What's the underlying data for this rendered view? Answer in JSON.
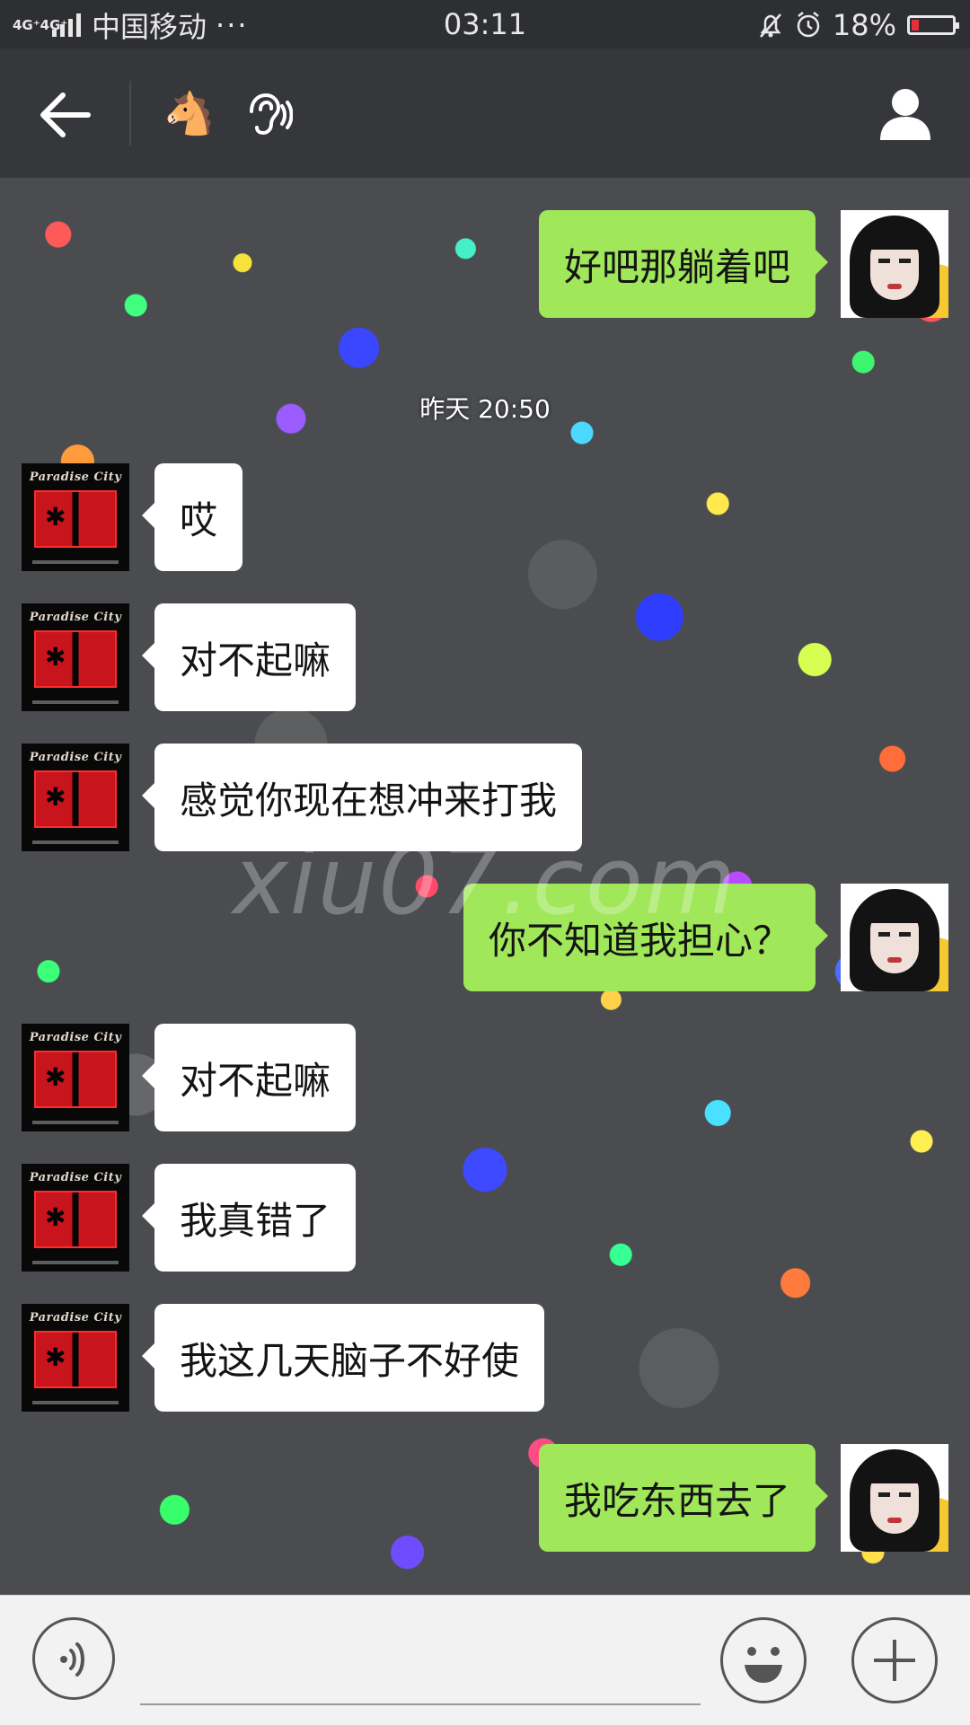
{
  "status_bar": {
    "network": "4G⁺4G⁺",
    "carrier": "中国移动",
    "more": "···",
    "time": "03:11",
    "battery": "18%",
    "battery_level": 0.18,
    "battery_color": "#e3303a"
  },
  "header": {
    "back_icon": "arrow-left-icon",
    "contact_emoji": "🐴",
    "earpiece_icon": "earpiece-icon",
    "profile_icon": "person-icon"
  },
  "avatars": {
    "peer_logo_text": "Paradise City"
  },
  "messages": [
    {
      "from": "self",
      "text": "好吧那躺着吧"
    },
    {
      "type": "timestamp",
      "text": "昨天 20:50"
    },
    {
      "from": "peer",
      "text": "哎"
    },
    {
      "from": "peer",
      "text": "对不起嘛"
    },
    {
      "from": "peer",
      "text": "感觉你现在想冲来打我"
    },
    {
      "from": "self",
      "text": "你不知道我担心？"
    },
    {
      "from": "peer",
      "text": "对不起嘛"
    },
    {
      "from": "peer",
      "text": "我真错了"
    },
    {
      "from": "peer",
      "text": "我这几天脑子不好使"
    },
    {
      "from": "self",
      "text": "我吃东西去了"
    }
  ],
  "watermark": "xiu07.com",
  "input_bar": {
    "voice_icon": "voice-icon",
    "emoji_icon": "smiley-icon",
    "plus_icon": "plus-icon"
  },
  "colors": {
    "self_bubble": "#a0e75a",
    "peer_bubble": "#ffffff",
    "header_bg": "#35373b",
    "status_bg": "#2e2f32"
  }
}
